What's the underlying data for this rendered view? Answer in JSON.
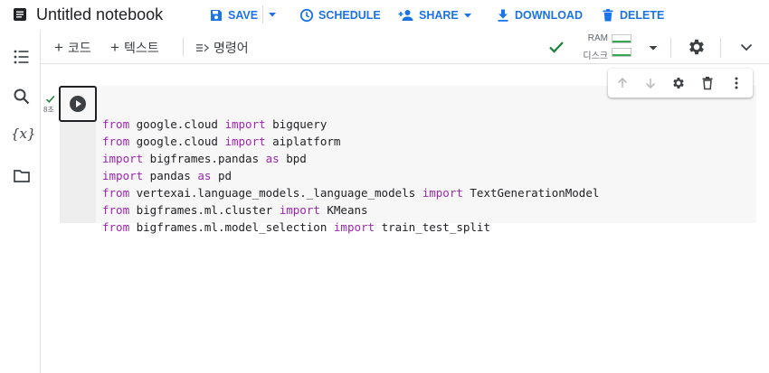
{
  "header": {
    "title": "Untitled notebook",
    "buttons": {
      "save": "SAVE",
      "schedule": "SCHEDULE",
      "share": "SHARE",
      "download": "DOWNLOAD",
      "delete": "DELETE"
    },
    "accent_color": "#1a73e8"
  },
  "left_rail": {
    "icons": [
      "table-of-contents-icon",
      "search-icon",
      "variables-icon",
      "files-icon"
    ],
    "variables_glyph": "{x}"
  },
  "toolbar": {
    "add_code": "코드",
    "add_text": "텍스트",
    "command_palette": "명령어",
    "resources": {
      "ram_label": "RAM",
      "disk_label": "디스크"
    }
  },
  "cell": {
    "exec_time": "8초",
    "code_lines": [
      [
        {
          "t": "from",
          "k": true
        },
        {
          "t": " google.cloud "
        },
        {
          "t": "import",
          "k": true
        },
        {
          "t": " bigquery"
        }
      ],
      [
        {
          "t": "from",
          "k": true
        },
        {
          "t": " google.cloud "
        },
        {
          "t": "import",
          "k": true
        },
        {
          "t": " aiplatform"
        }
      ],
      [
        {
          "t": "import",
          "k": true
        },
        {
          "t": " bigframes.pandas "
        },
        {
          "t": "as",
          "k": true
        },
        {
          "t": " bpd"
        }
      ],
      [
        {
          "t": "import",
          "k": true
        },
        {
          "t": " pandas "
        },
        {
          "t": "as",
          "k": true
        },
        {
          "t": " pd"
        }
      ],
      [
        {
          "t": "from",
          "k": true
        },
        {
          "t": " vertexai.language_models._language_models "
        },
        {
          "t": "import",
          "k": true
        },
        {
          "t": " TextGenerationModel"
        }
      ],
      [
        {
          "t": "from",
          "k": true
        },
        {
          "t": " bigframes.ml.cluster "
        },
        {
          "t": "import",
          "k": true
        },
        {
          "t": " KMeans"
        }
      ],
      [
        {
          "t": "from",
          "k": true
        },
        {
          "t": " bigframes.ml.model_selection "
        },
        {
          "t": "import",
          "k": true
        },
        {
          "t": " train_test_split"
        }
      ]
    ],
    "keyword_color": "#9c27b0"
  }
}
